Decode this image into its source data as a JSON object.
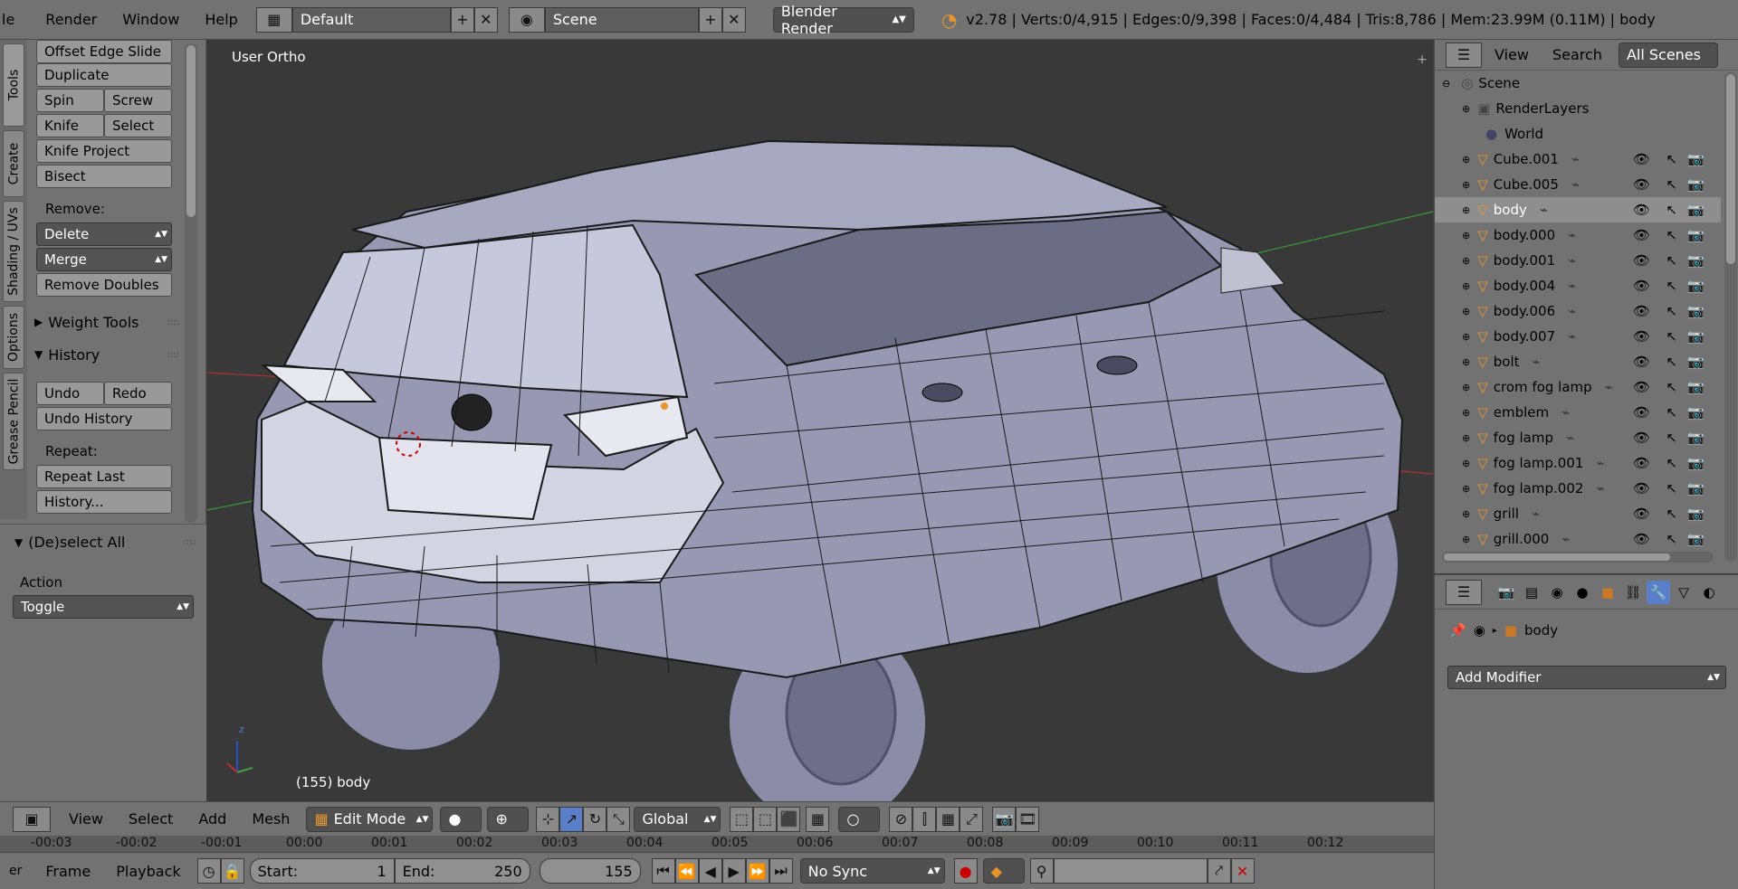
{
  "topbar": {
    "menus": [
      "le",
      "Render",
      "Window",
      "Help"
    ],
    "layout": "Default",
    "scene": "Scene",
    "engine": "Blender Render",
    "stats": "v2.78 | Verts:0/4,915 | Edges:0/9,398 | Faces:0/4,484 | Tris:8,786 | Mem:23.99M (0.11M) | body"
  },
  "tabs": [
    "Tools",
    "Create",
    "Shading / UVs",
    "Options",
    "Grease Pencil"
  ],
  "tools": {
    "offset_edge_slide": "Offset Edge Slide",
    "duplicate": "Duplicate",
    "spin": "Spin",
    "screw": "Screw",
    "knife": "Knife",
    "select": "Select",
    "knife_project": "Knife Project",
    "bisect": "Bisect",
    "remove_label": "Remove:",
    "delete": "Delete",
    "merge": "Merge",
    "remove_doubles": "Remove Doubles",
    "weight_tools": "Weight Tools",
    "history": "History",
    "undo": "Undo",
    "redo": "Redo",
    "undo_history": "Undo History",
    "repeat_label": "Repeat:",
    "repeat_last": "Repeat Last",
    "history_dots": "History..."
  },
  "operator": {
    "title": "(De)select All",
    "action_label": "Action",
    "action_value": "Toggle"
  },
  "viewport": {
    "view_label": "User Ortho",
    "object_label": "(155) body",
    "axis_z": "z"
  },
  "outliner": {
    "view": "View",
    "search": "Search",
    "filter": "All Scenes",
    "scene": "Scene",
    "renderlayers": "RenderLayers",
    "world": "World",
    "objects": [
      "Cube.001",
      "Cube.005",
      "body",
      "body.000",
      "body.001",
      "body.004",
      "body.006",
      "body.007",
      "bolt",
      "crom fog lamp",
      "emblem",
      "fog lamp",
      "fog lamp.001",
      "fog lamp.002",
      "grill",
      "grill.000"
    ]
  },
  "properties": {
    "object": "body",
    "add_modifier": "Add Modifier"
  },
  "vheader": {
    "view": "View",
    "select": "Select",
    "add": "Add",
    "mesh": "Mesh",
    "mode": "Edit Mode",
    "orientation": "Global"
  },
  "timeline": {
    "ticks": [
      "-00:03",
      "-00:02",
      "-00:01",
      "00:00",
      "00:01",
      "00:02",
      "00:03",
      "00:04",
      "00:05",
      "00:06",
      "00:07",
      "00:08",
      "00:09",
      "00:10",
      "00:11",
      "00:12"
    ]
  },
  "tlheader": {
    "frame": "Frame",
    "playback": "Playback",
    "start_label": "Start:",
    "start": "1",
    "end_label": "End:",
    "end": "250",
    "current": "155",
    "sync": "No Sync"
  },
  "colors": {
    "orange": "#e8962a",
    "highlight": "#5b7ec9"
  }
}
